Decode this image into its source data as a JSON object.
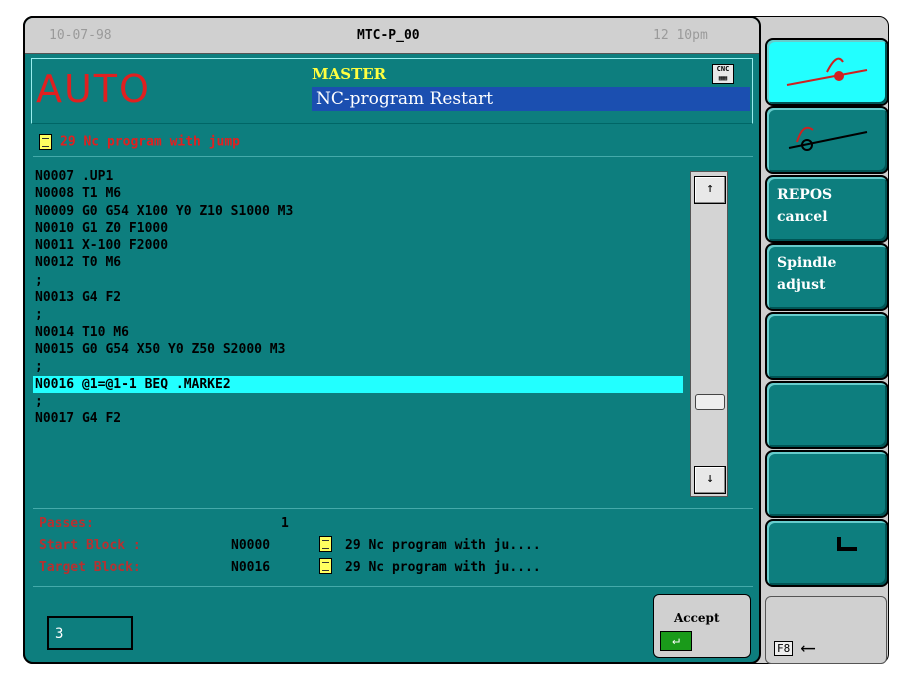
{
  "titlebar": {
    "date": "10-07-98",
    "program": "MTC-P_00",
    "time": "12 10pm"
  },
  "header": {
    "mode": "AUTO",
    "channel": "MASTER",
    "function": "NC-program Restart",
    "cnc_icon_text": "CNC"
  },
  "program_line": "29 Nc program with jump",
  "code_lines": [
    "N0007 .UP1",
    "N0008 T1 M6",
    "N0009 G0 G54 X100 Y0 Z10 S1000 M3",
    "N0010 G1 Z0 F1000",
    "N0011 X-100 F2000",
    "N0012 T0 M6",
    ";",
    "N0013 G4 F2",
    ";",
    "N0014 T10 M6",
    "N0015 G0 G54 X50 Y0 Z50 S2000 M3",
    ";",
    "N0016 @1=@1-1 BEQ .MARKE2",
    ";",
    "N0017 G4 F2"
  ],
  "selected_line_index": 12,
  "info": {
    "passes_label": "Passes:",
    "passes_value": "1",
    "start_label": "Start Block :",
    "start_block": "N0000",
    "start_program": "29 Nc program with ju....",
    "target_label": "Target Block:",
    "target_block": "N0016",
    "target_program": "29 Nc program with ju...."
  },
  "input_value": "3",
  "accept_label": "Accept",
  "softkeys": [
    "",
    "",
    "REPOS\ncancel",
    "Spindle\nadjust",
    "",
    "",
    "",
    ""
  ],
  "f8_label": "F8",
  "scrollbar": {
    "up": "↑",
    "down": "↓"
  }
}
